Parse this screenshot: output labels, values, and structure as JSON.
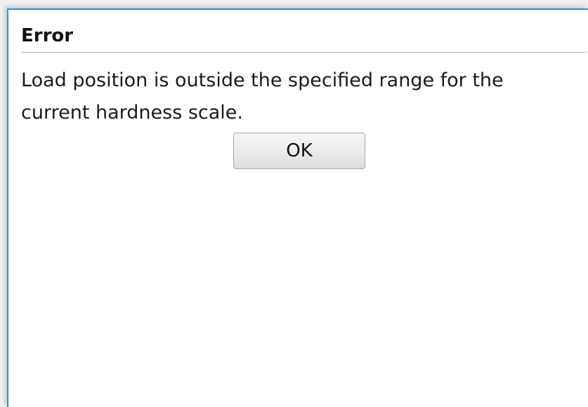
{
  "dialog": {
    "title": "Error",
    "message": "Load position is outside the specified range for the current hardness scale.",
    "ok_label": "OK",
    "accent_color": "#3a8fc9"
  }
}
